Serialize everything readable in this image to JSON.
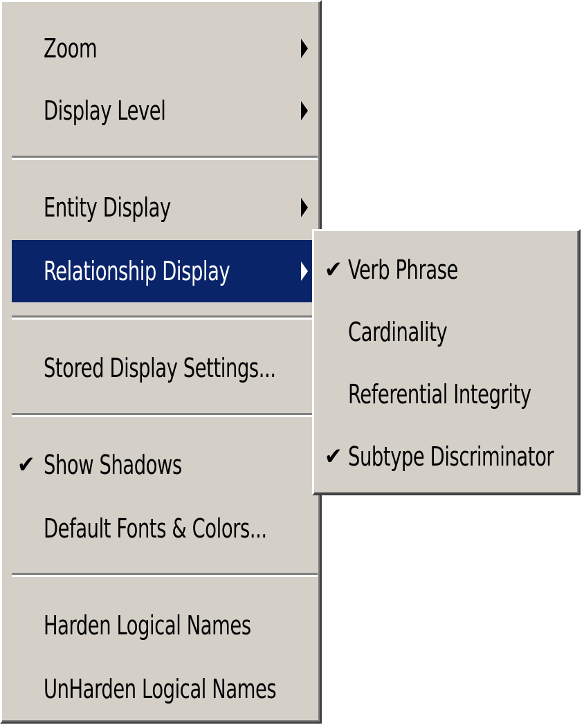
{
  "menu": {
    "items": [
      {
        "label": "Zoom",
        "has_submenu": true,
        "checked": false
      },
      {
        "label": "Display Level",
        "has_submenu": true,
        "checked": false
      },
      {
        "label": "Entity Display",
        "has_submenu": true,
        "checked": false
      },
      {
        "label": "Relationship Display",
        "has_submenu": true,
        "checked": false,
        "highlighted": true
      },
      {
        "label": "Stored Display Settings...",
        "has_submenu": false,
        "checked": false
      },
      {
        "label": "Show Shadows",
        "has_submenu": false,
        "checked": true
      },
      {
        "label": "Default Fonts & Colors...",
        "has_submenu": false,
        "checked": false
      },
      {
        "label": "Harden Logical Names",
        "has_submenu": false,
        "checked": false
      },
      {
        "label": "UnHarden Logical Names",
        "has_submenu": false,
        "checked": false
      }
    ],
    "check_glyph": "✔"
  },
  "submenu": {
    "items": [
      {
        "label": "Verb Phrase",
        "checked": true
      },
      {
        "label": "Cardinality",
        "checked": false
      },
      {
        "label": "Referential Integrity",
        "checked": false
      },
      {
        "label": "Subtype Discriminator",
        "checked": true
      }
    ]
  },
  "colors": {
    "menu_bg": "#d4d0c8",
    "highlight_bg": "#0a246a",
    "highlight_text": "#ffffff",
    "text": "#000000"
  }
}
